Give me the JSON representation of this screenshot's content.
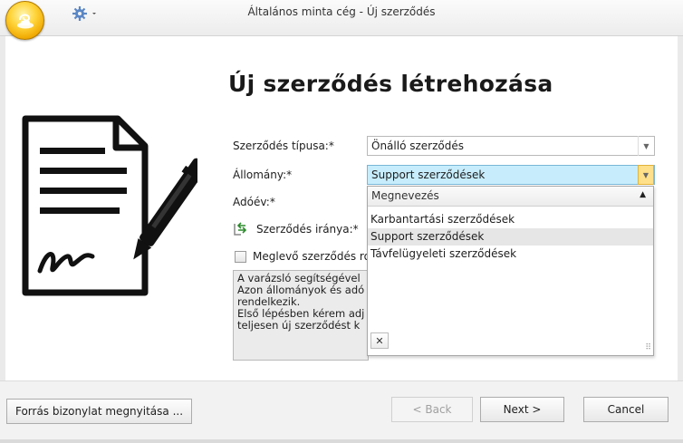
{
  "window": {
    "title": "Általános minta cég - Új szerződés"
  },
  "heading": "Új szerződés létrehozása",
  "form": {
    "contract_type_label": "Szerződés típusa:*",
    "contract_type_value": "Önálló szerződés",
    "stock_label": "Állomány:*",
    "stock_value": "Support szerződések",
    "tax_year_label": "Adóév:*",
    "direction_label": "Szerződés iránya:*",
    "existing_checkbox_label": "Meglevő szerződés ro"
  },
  "info_text": [
    "A varázsló segítségével",
    "Azon állományok és adó",
    "rendelkezik.",
    "Első lépésben kérem adj",
    "teljesen új szerződést k"
  ],
  "dropdown": {
    "header": "Megnevezés",
    "items": [
      "Karbantartási szerződések",
      "Support szerződések",
      "Távfelügyeleti szerződések"
    ],
    "selected": "Support szerződések"
  },
  "buttons": {
    "open_source": "Forrás bizonylat megnyitása ...",
    "back": "< Back",
    "next": "Next >",
    "cancel": "Cancel"
  },
  "colors": {
    "highlight": "#c7edfc",
    "dropdown_button": "#ffe08a",
    "orb": "#ffd43a"
  }
}
